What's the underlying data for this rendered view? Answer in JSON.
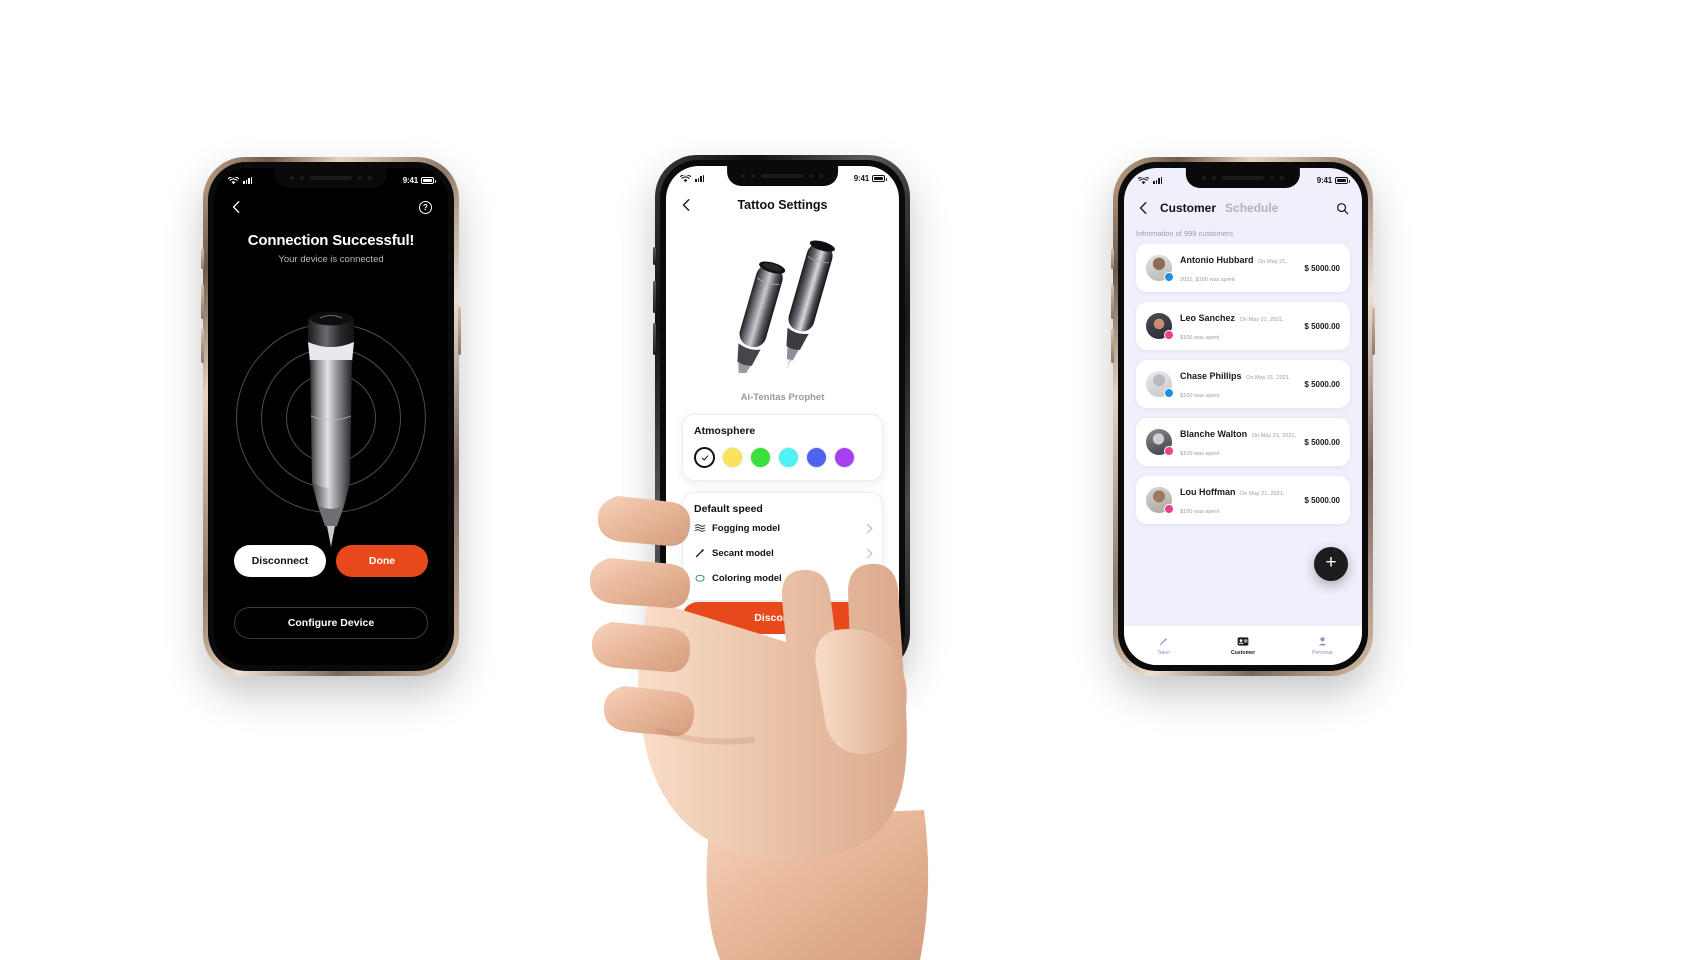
{
  "phone1": {
    "status": {
      "time": "9:41",
      "wifi_icon": "wifi-icon",
      "signal_icon": "signal-icon",
      "battery_icon": "battery-icon"
    },
    "nav": {
      "back_icon": "back-arrow-icon",
      "help_icon": "help-circle-icon",
      "help_label": "?"
    },
    "title": "Connection Successful!",
    "subtitle": "Your device is connected",
    "device_image": "tattoo-pen-image",
    "buttons": {
      "disconnect": "Disconnect",
      "done": "Done",
      "configure": "Configure Device"
    },
    "colors": {
      "accent": "#e8491c",
      "background": "#000000"
    }
  },
  "phone2": {
    "status": {
      "time": "9:41",
      "wifi_icon": "wifi-icon",
      "signal_icon": "signal-icon",
      "battery_icon": "battery-icon"
    },
    "nav": {
      "back_icon": "back-arrow-icon",
      "title": "Tattoo Settings"
    },
    "model_name": "Ai-Tenitas Prophet",
    "device_image": "tattoo-pen-pair-image",
    "atmosphere": {
      "title": "Atmosphere",
      "swatches": [
        {
          "name": "selected-check",
          "color": "#ffffff",
          "selected": true
        },
        {
          "name": "yellow",
          "color": "#fbe25c",
          "selected": false
        },
        {
          "name": "green",
          "color": "#3ae13a",
          "selected": false
        },
        {
          "name": "cyan",
          "color": "#4ef2f2",
          "selected": false
        },
        {
          "name": "blue",
          "color": "#4f63ec",
          "selected": false
        },
        {
          "name": "purple",
          "color": "#a741ef",
          "selected": false
        }
      ]
    },
    "default_speed": {
      "title": "Default speed",
      "items": [
        {
          "label": "Fogging model",
          "icon": "waves-icon"
        },
        {
          "label": "Secant model",
          "icon": "pen-stroke-icon"
        },
        {
          "label": "Coloring  model",
          "icon": "blob-icon"
        }
      ]
    },
    "disconnect_label": "Disconnect",
    "colors": {
      "accent": "#e8491c",
      "background": "#ffffff"
    }
  },
  "phone3": {
    "status": {
      "time": "9:41",
      "wifi_icon": "wifi-icon",
      "signal_icon": "signal-icon",
      "battery_icon": "battery-icon"
    },
    "nav": {
      "back_icon": "back-arrow-icon",
      "tab_customer": "Customer",
      "tab_schedule": "Schedule",
      "search_icon": "search-icon"
    },
    "info_bar": "Information of 999 customers",
    "customers": [
      {
        "name": "Antonio Hubbard",
        "sub": "On May 21, 2021, $100 was spent",
        "amount": "$ 5000.00",
        "badge": "verified-badge",
        "badge_color": "#1d8fe8"
      },
      {
        "name": "Leo Sanchez",
        "sub": "On May 21, 2021, $100 was spent",
        "amount": "$ 5000.00",
        "badge": "star-badge",
        "badge_color": "#ef3f86"
      },
      {
        "name": "Chase Phillips",
        "sub": "On May 21, 2021, $100 was spent",
        "amount": "$ 5000.00",
        "badge": "verified-badge",
        "badge_color": "#1d8fe8"
      },
      {
        "name": "Blanche Walton",
        "sub": "On May 21, 2021, $100 was spent",
        "amount": "$ 5000.00",
        "badge": "star-badge",
        "badge_color": "#ef3f86"
      },
      {
        "name": "Lou Hoffman",
        "sub": "On May 21, 2021, $100 was spent",
        "amount": "$ 5000.00",
        "badge": "star-badge",
        "badge_color": "#ef3f86"
      }
    ],
    "fab_label": "+",
    "tabbar": [
      {
        "label": "Tatoo",
        "icon": "tattoo-pen-icon",
        "active": false
      },
      {
        "label": "Customer",
        "icon": "customer-card-icon",
        "active": true
      },
      {
        "label": "Personal",
        "icon": "person-icon",
        "active": false
      }
    ],
    "colors": {
      "background": "#eff0fb",
      "card": "#ffffff",
      "fab": "#1d1d1f"
    }
  }
}
